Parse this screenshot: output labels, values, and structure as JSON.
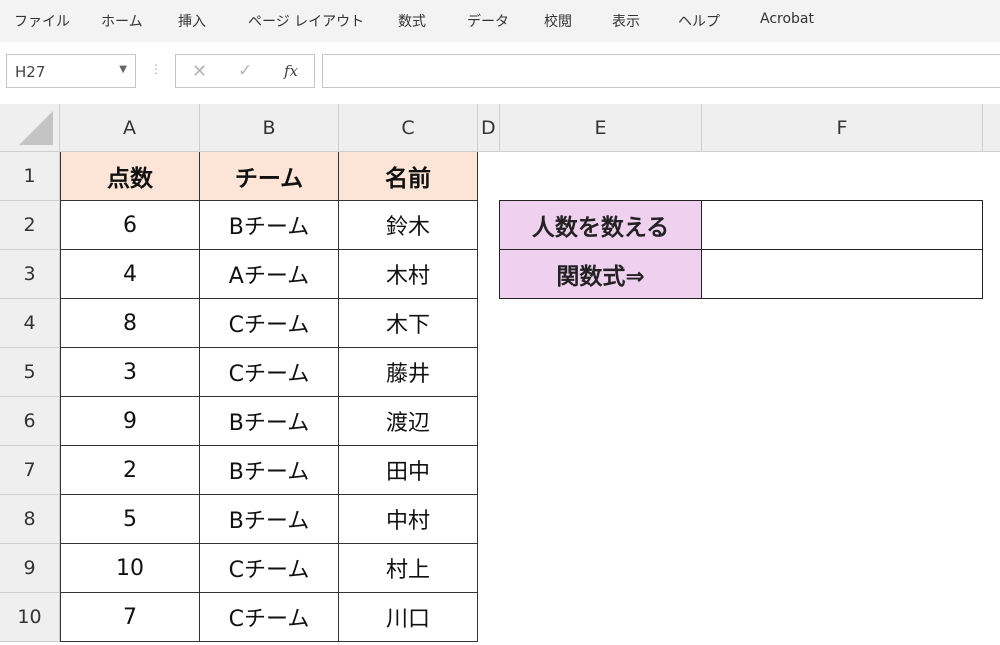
{
  "ribbon": {
    "tabs": [
      "ファイル",
      "ホーム",
      "挿入",
      "ページ レイアウト",
      "数式",
      "データ",
      "校閲",
      "表示",
      "ヘルプ",
      "Acrobat"
    ]
  },
  "formula_bar": {
    "name_box": "H27",
    "cancel_icon": "✕",
    "enter_icon": "✓",
    "fx_label": "fx",
    "formula": ""
  },
  "grid": {
    "columns": [
      "A",
      "B",
      "C",
      "D",
      "E",
      "F"
    ],
    "rows": [
      "1",
      "2",
      "3",
      "4",
      "5",
      "6",
      "7",
      "8",
      "9",
      "10"
    ]
  },
  "table": {
    "headers": [
      "点数",
      "チーム",
      "名前"
    ],
    "rows": [
      [
        "6",
        "Bチーム",
        "鈴木"
      ],
      [
        "4",
        "Aチーム",
        "木村"
      ],
      [
        "8",
        "Cチーム",
        "木下"
      ],
      [
        "3",
        "Cチーム",
        "藤井"
      ],
      [
        "9",
        "Bチーム",
        "渡辺"
      ],
      [
        "2",
        "Bチーム",
        "田中"
      ],
      [
        "5",
        "Bチーム",
        "中村"
      ],
      [
        "10",
        "Cチーム",
        "村上"
      ],
      [
        "7",
        "Cチーム",
        "川口"
      ]
    ]
  },
  "side_table": {
    "label1": "人数を数える",
    "label2": "関数式⇒",
    "value1": "",
    "value2": ""
  },
  "colors": {
    "header_fill": "#fce4d6",
    "label_fill": "#efd0ef"
  }
}
